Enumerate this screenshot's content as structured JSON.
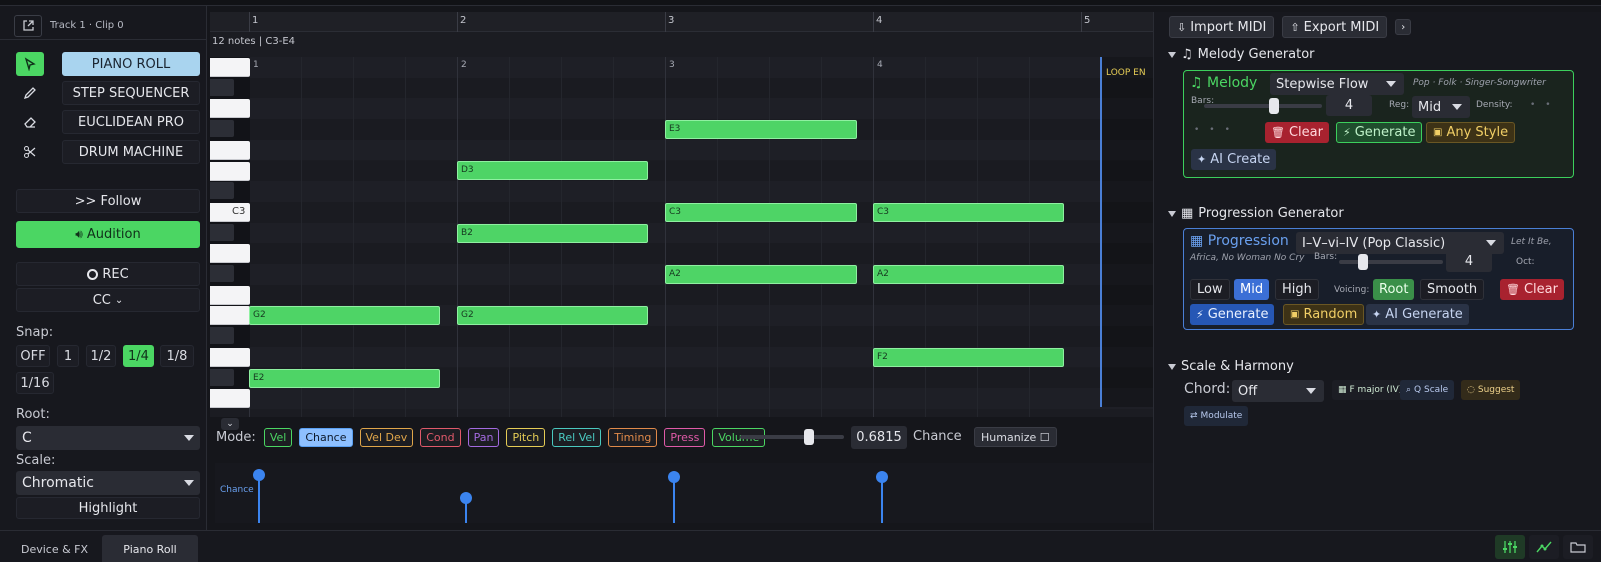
{
  "clip": {
    "title": "Track 1 · Clip 0"
  },
  "tools": {
    "select_icon": "cursor-icon",
    "pencil_icon": "pencil-icon",
    "eraser_icon": "eraser-icon",
    "scissors_icon": "scissors-icon"
  },
  "modes": [
    "PIANO ROLL",
    "STEP SEQUENCER",
    "EUCLIDEAN PRO",
    "DRUM MACHINE"
  ],
  "follow": ">> Follow",
  "audition": "Audition",
  "rec": "REC",
  "cc": "CC",
  "snap": {
    "label": "Snap:",
    "options": [
      "OFF",
      "1",
      "1/2",
      "1/4",
      "1/8",
      "1/16"
    ],
    "selected": "1/4"
  },
  "root": {
    "label": "Root:",
    "value": "C"
  },
  "scale": {
    "label": "Scale:",
    "value": "Chromatic"
  },
  "highlight": "Highlight",
  "ruler": {
    "bars": [
      "1",
      "2",
      "3",
      "4",
      "5"
    ]
  },
  "grid_bars": [
    "1",
    "2",
    "3",
    "4"
  ],
  "info": "12 notes | C3-E4",
  "loop_label": "LOOP EN",
  "key_label": "C3",
  "notes": [
    {
      "label": "E3"
    },
    {
      "label": "D3"
    },
    {
      "label": "C3"
    },
    {
      "label": "C3"
    },
    {
      "label": "B2"
    },
    {
      "label": "A2"
    },
    {
      "label": "A2"
    },
    {
      "label": "G2"
    },
    {
      "label": "G2"
    },
    {
      "label": "F2"
    },
    {
      "label": "E2"
    }
  ],
  "modebar": {
    "label": "Mode:",
    "chips": [
      {
        "label": "Vel",
        "color": "#4bd663"
      },
      {
        "label": "Chance",
        "color": "#5aa0f2",
        "active": true
      },
      {
        "label": "Vel Dev",
        "color": "#e0a64a"
      },
      {
        "label": "Cond",
        "color": "#e0596a"
      },
      {
        "label": "Pan",
        "color": "#a36ae0"
      },
      {
        "label": "Pitch",
        "color": "#e5cc55"
      },
      {
        "label": "Rel Vel",
        "color": "#4ac9c0"
      },
      {
        "label": "Timing",
        "color": "#e08a4a"
      },
      {
        "label": "Press",
        "color": "#e05aa8"
      },
      {
        "label": "Volume",
        "color": "#4bd663"
      }
    ],
    "value": "0.6815",
    "value_label": "Chance",
    "humanize": "Humanize ☐"
  },
  "lane": {
    "label": "Chance",
    "values": [
      0.85,
      0.45,
      0.82,
      0.82
    ]
  },
  "right": {
    "import": "Import MIDI",
    "export": "Export MIDI",
    "melody_section": "Melody Generator",
    "melody": {
      "title": "Melody",
      "style": "Stepwise Flow",
      "style_hint": "Pop · Folk · Singer-Songwriter",
      "bars_label": "Bars:",
      "bars_value": "4",
      "bars_fraction": 0.6,
      "reg_label": "Reg:",
      "reg_value": "Mid",
      "density_label": "Density:",
      "clear": "Clear",
      "generate": "Generate",
      "any_style": "Any Style",
      "ai_create": "AI Create"
    },
    "progression_section": "Progression Generator",
    "progression": {
      "title": "Progression",
      "preset": "I–V–vi–IV (Pop Classic)",
      "hint_a": "Let It Be,",
      "hint_b": "Africa, No Woman No Cry",
      "bars_label": "Bars:",
      "bars_value": "4",
      "bars_fraction": 0.2,
      "oct_label": "Oct:",
      "low": "Low",
      "mid": "Mid",
      "high": "High",
      "voicing_label": "Voicing:",
      "root": "Root",
      "smooth": "Smooth",
      "clear": "Clear",
      "generate": "Generate",
      "random": "Random",
      "ai_generate": "AI Generate"
    },
    "scale_section": "Scale & Harmony",
    "scale_harmony": {
      "chord_label": "Chord:",
      "chord_value": "Off",
      "key": "F major (IV)",
      "q_scale": "Q Scale",
      "suggest": "Suggest",
      "modulate": "Modulate"
    }
  },
  "bottom": {
    "tabs": [
      "Device & FX",
      "Piano Roll"
    ],
    "active": "Piano Roll"
  }
}
